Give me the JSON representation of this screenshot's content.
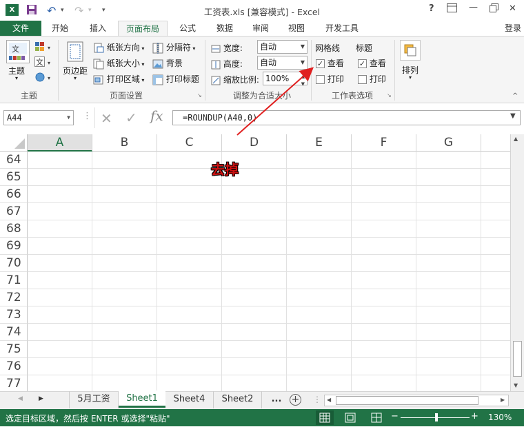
{
  "titlebar": {
    "title": "工资表.xls  [兼容模式] - Excel",
    "excel_icon": "excel-logo",
    "help": "?",
    "minimize": "—",
    "close": "✕"
  },
  "tabs": {
    "file": "文件",
    "items": [
      "开始",
      "插入",
      "页面布局",
      "公式",
      "数据",
      "审阅",
      "视图",
      "开发工具"
    ],
    "active": "页面布局",
    "login": "登录"
  },
  "ribbon": {
    "theme_group": {
      "label": "主题",
      "theme_btn": "主题"
    },
    "page_setup": {
      "label": "页面设置",
      "margins": "页边距",
      "orientation": "纸张方向",
      "size": "纸张大小",
      "print_area": "打印区域",
      "breaks": "分隔符",
      "background": "背景",
      "print_titles": "打印标题"
    },
    "scale": {
      "label": "调整为合适大小",
      "width_label": "宽度:",
      "width_value": "自动",
      "height_label": "高度:",
      "height_value": "自动",
      "scale_label": "缩放比例:",
      "scale_value": "100%"
    },
    "sheet_options": {
      "label": "工作表选项",
      "gridlines": "网格线",
      "headings": "标题",
      "view": "查看",
      "print": "打印",
      "gridlines_view": true,
      "headings_view": true
    },
    "arrange": {
      "label": "排列"
    }
  },
  "formula_bar": {
    "name_box": "A44",
    "fx": "fx",
    "formula": "=ROUNDUP(A40,0)"
  },
  "grid": {
    "columns": [
      "A",
      "B",
      "C",
      "D",
      "E",
      "F",
      "G"
    ],
    "rows": [
      "64",
      "65",
      "66",
      "67",
      "68",
      "69",
      "70",
      "71",
      "72",
      "73",
      "74",
      "75",
      "76",
      "77"
    ],
    "selected_column": "A"
  },
  "annotation": {
    "text": "去掉",
    "color": "#cc1111"
  },
  "sheets": {
    "tabs": [
      "5月工资",
      "Sheet1",
      "Sheet4",
      "Sheet2"
    ],
    "active": "Sheet1",
    "more": "..."
  },
  "status": {
    "message": "选定目标区域，然后按 ENTER 或选择\"粘贴\"",
    "zoom": "130%"
  },
  "colors": {
    "accent": "#217346"
  }
}
